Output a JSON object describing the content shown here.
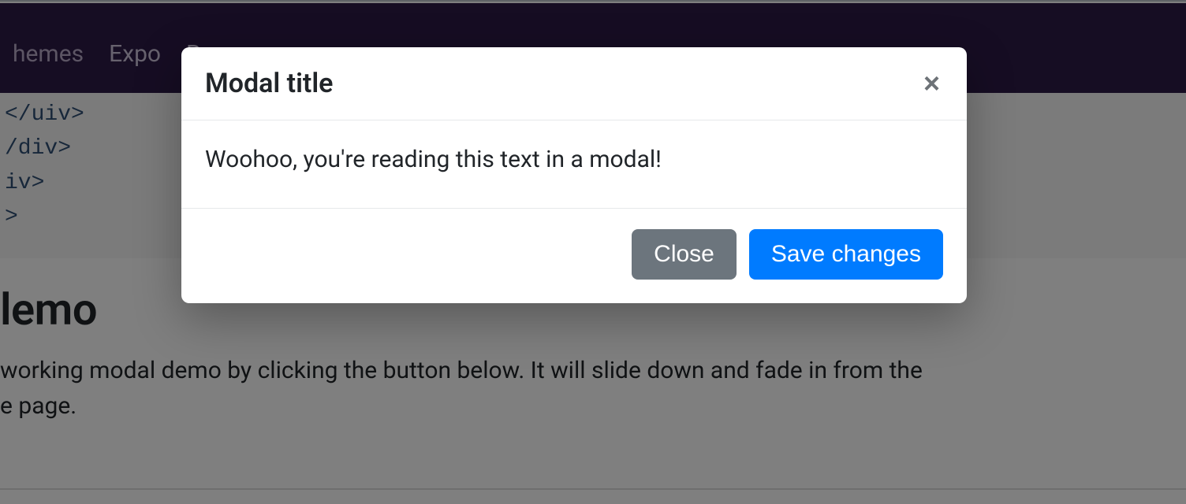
{
  "nav": {
    "item1": "hemes",
    "item2": "Expo",
    "item3": "B"
  },
  "code": {
    "l1": "</uiv>",
    "l2": "/div>",
    "l3": "iv>",
    "l4": ">"
  },
  "page": {
    "heading": "lemo",
    "paragraph_line1": "working modal demo by clicking the button below. It will slide down and fade in from the",
    "paragraph_line2": "e page."
  },
  "modal": {
    "title": "Modal title",
    "body": "Woohoo, you're reading this text in a modal!",
    "close_label": "Close",
    "save_label": "Save changes",
    "close_icon": "×"
  }
}
